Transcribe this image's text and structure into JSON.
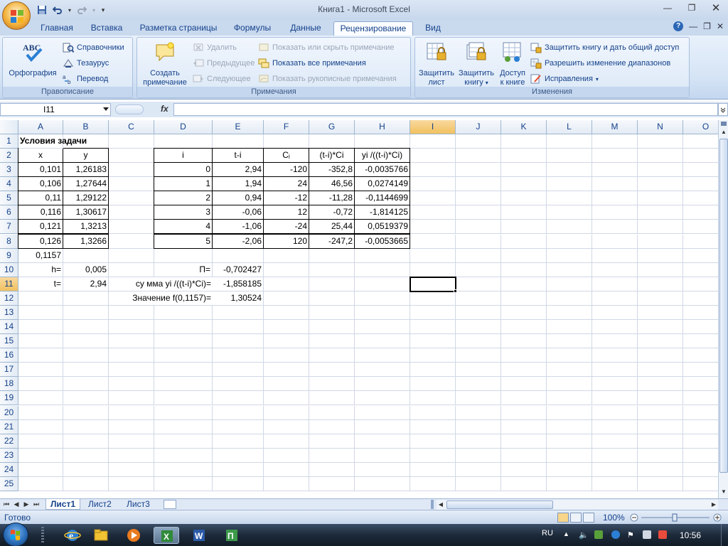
{
  "window": {
    "title": "Книга1 - Microsoft Excel"
  },
  "tabs": [
    "Главная",
    "Вставка",
    "Разметка страницы",
    "Формулы",
    "Данные",
    "Рецензирование",
    "Вид"
  ],
  "active_tab": "Рецензирование",
  "ribbon": {
    "proofing": {
      "label": "Правописание",
      "spelling": "Орфография",
      "research": "Справочники",
      "thesaurus": "Тезаурус",
      "translate": "Перевод"
    },
    "comments": {
      "label": "Примечания",
      "new": "Создать примечание",
      "new_line1": "Создать",
      "new_line2": "примечание",
      "delete": "Удалить",
      "previous": "Предыдущее",
      "next": "Следующее",
      "show_hide": "Показать или скрыть примечание",
      "show_all": "Показать все примечания",
      "show_ink": "Показать рукописные примечания"
    },
    "changes": {
      "label": "Изменения",
      "protect_sheet_1": "Защитить",
      "protect_sheet_2": "лист",
      "protect_book_1": "Защитить",
      "protect_book_2": "книгу",
      "share_1": "Доступ",
      "share_2": "к книге",
      "protect_share": "Защитить книгу и дать общий доступ",
      "allow_ranges": "Разрешить изменение диапазонов",
      "track": "Исправления"
    }
  },
  "formula_bar": {
    "name_box": "I11",
    "fx": "fx",
    "formula": ""
  },
  "columns": [
    "A",
    "B",
    "C",
    "D",
    "E",
    "F",
    "G",
    "H",
    "I",
    "J",
    "K",
    "L",
    "M",
    "N",
    "O"
  ],
  "selected_column": "I",
  "rows": [
    "1",
    "2",
    "3",
    "4",
    "5",
    "6",
    "7",
    "8",
    "9",
    "10",
    "11",
    "12",
    "13",
    "14",
    "15",
    "16",
    "17",
    "18",
    "19",
    "20",
    "21",
    "22",
    "23",
    "24",
    "25"
  ],
  "selected_row": "11",
  "cells": {
    "A1": "Условия задачи",
    "A2": "x",
    "B2": "y",
    "A3": "0,101",
    "B3": "1,26183",
    "A4": "0,106",
    "B4": "1,27644",
    "A5": "0,11",
    "B5": "1,29122",
    "A6": "0,116",
    "B6": "1,30617",
    "A7": "0,121",
    "B7": "1,3213",
    "A8": "0,126",
    "B8": "1,3266",
    "A9": "0,1157",
    "A10": "h=",
    "B10": "0,005",
    "A11": "t=",
    "B11": "2,94",
    "D2": "i",
    "E2": "t-i",
    "F2": "Cᵢ",
    "G2": "(t-i)*Ci",
    "H2": "yi /((t-i)*Ci)",
    "D3": "0",
    "E3": "2,94",
    "F3": "-120",
    "G3": "-352,8",
    "H3": "-0,0035766",
    "D4": "1",
    "E4": "1,94",
    "F4": "24",
    "G4": "46,56",
    "H4": "0,0274149",
    "D5": "2",
    "E5": "0,94",
    "F5": "-12",
    "G5": "-11,28",
    "H5": "-0,1144699",
    "D6": "3",
    "E6": "-0,06",
    "F6": "12",
    "G6": "-0,72",
    "H6": "-1,814125",
    "D7": "4",
    "E7": "-1,06",
    "F7": "-24",
    "G7": "25,44",
    "H7": "0,0519379",
    "D8": "5",
    "E8": "-2,06",
    "F8": "120",
    "G8": "-247,2",
    "H8": "-0,0053665",
    "D10": "П=",
    "E10": "-0,702427",
    "C11": "су мма yi /((t-i)*Ci)=",
    "E11": "-1,858185",
    "C12": "Значение f(0,1157)=",
    "E12": "1,30524"
  },
  "sheets": [
    "Лист1",
    "Лист2",
    "Лист3"
  ],
  "active_sheet": "Лист1",
  "status": {
    "ready": "Готово",
    "zoom": "100%"
  },
  "taskbar": {
    "lang": "RU",
    "time": "10:56"
  },
  "colors": {
    "accent": "#15428b",
    "ribbon_bg": "#d4e3f5",
    "selected_header": "#f1c15f"
  }
}
